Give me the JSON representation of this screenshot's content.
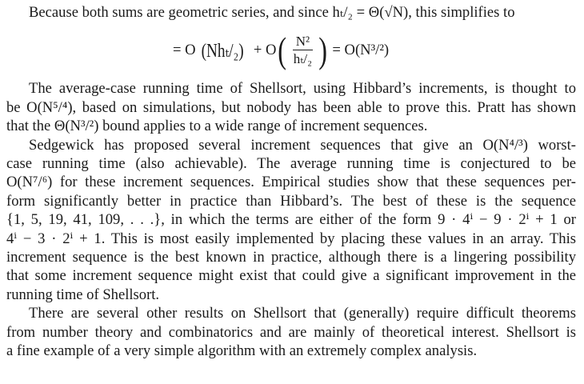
{
  "intro": "Because both sums are geometric series, and since hₜ/₂ = Θ(√N), this simplifies to",
  "equation": {
    "lead": "= O",
    "term1": "(Nhₜ/₂)",
    "plus": "+ O",
    "frac_num": "N²",
    "frac_den": "hₜ/₂",
    "result": "= O(N³/²)"
  },
  "paragraphs": [
    {
      "name": "paragraph-average-case",
      "lines": [
        "The average-case running time of Shellsort, using Hibbard’s increments, is thought to",
        "be O(N⁵/⁴), based on simulations, but nobody has been able to prove this. Pratt has shown",
        "that the Θ(N³/²) bound applies to a wide range of increment sequences."
      ]
    },
    {
      "name": "paragraph-sedgewick",
      "lines": [
        "Sedgewick has proposed several increment sequences that give an O(N⁴/³) worst-",
        "case running time (also achievable). The average running time is conjectured to be",
        "O(N⁷/⁶) for these increment sequences. Empirical studies show that these sequences per-",
        "form significantly better in practice than Hibbard’s. The best of these is the sequence",
        "{1, 5, 19, 41, 109, . . .}, in which the terms are either of the form 9 · 4ⁱ − 9 · 2ⁱ + 1 or",
        "4ⁱ − 3 · 2ⁱ + 1. This is most easily implemented by placing these values in an array. This",
        "increment sequence is the best known in practice, although there is a lingering possibility",
        "that some increment sequence might exist that could give a significant improvement in the",
        "running time of Shellsort."
      ]
    },
    {
      "name": "paragraph-other-results",
      "lines": [
        "There are several other results on Shellsort that (generally) require difficult theorems",
        "from number theory and combinatorics and are mainly of theoretical interest. Shellsort is",
        "a fine example of a very simple algorithm with an extremely complex analysis."
      ]
    }
  ]
}
